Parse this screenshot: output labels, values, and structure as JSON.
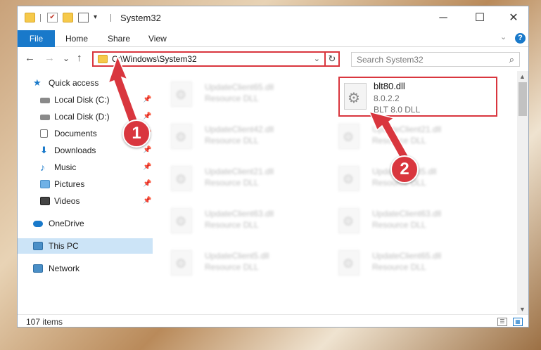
{
  "window": {
    "title": "System32",
    "minimize_glyph": "─",
    "maximize_glyph": "☐",
    "close_glyph": "✕",
    "qat_dropdown_glyph": "▾"
  },
  "ribbon": {
    "tabs": [
      "File",
      "Home",
      "Share",
      "View"
    ],
    "expand_glyph": "⌄",
    "help_glyph": "?"
  },
  "nav": {
    "back": "←",
    "forward": "→",
    "recent": "⌄",
    "up": "↑",
    "address": "C:\\Windows\\System32",
    "address_dropdown": "⌄",
    "refresh": "↻",
    "search_placeholder": "Search System32",
    "search_icon": "⌕"
  },
  "sidebar": {
    "pin_glyph": "📌",
    "items": [
      {
        "label": "Quick access",
        "icon": "star-icon",
        "pinned": false
      },
      {
        "label": "Local Disk (C:)",
        "icon": "drive-icon",
        "pinned": true
      },
      {
        "label": "Local Disk (D:)",
        "icon": "drive-icon",
        "pinned": true
      },
      {
        "label": "Documents",
        "icon": "documents-icon",
        "pinned": true
      },
      {
        "label": "Downloads",
        "icon": "downloads-icon",
        "pinned": true
      },
      {
        "label": "Music",
        "icon": "music-icon",
        "pinned": true
      },
      {
        "label": "Pictures",
        "icon": "pictures-icon",
        "pinned": true
      },
      {
        "label": "Videos",
        "icon": "videos-icon",
        "pinned": true
      },
      {
        "label": "OneDrive",
        "icon": "onedrive-icon",
        "pinned": false
      },
      {
        "label": "This PC",
        "icon": "computer-icon",
        "pinned": false
      },
      {
        "label": "Network",
        "icon": "network-icon",
        "pinned": false
      }
    ]
  },
  "files": [
    {
      "name": "UpdateClient65.dll",
      "desc": "Resource DLL"
    },
    {
      "name": "UpdateClient42.dll",
      "desc": "Resource DLL"
    },
    {
      "name": "UpdateClient21.dll",
      "desc": "Resource DLL"
    },
    {
      "name": "UpdateClient21.dll",
      "desc": "Resource DLL"
    },
    {
      "name": "UpdateClient5.dll",
      "desc": "Resource DLL"
    },
    {
      "name": "UpdateClient63.dll",
      "desc": "Resource DLL"
    },
    {
      "name": "UpdateClient63.dll",
      "desc": "Resource DLL"
    },
    {
      "name": "UpdateClient5.dll",
      "desc": "Resource DLL"
    },
    {
      "name": "UpdateClient65.dll",
      "desc": "Resource DLL"
    }
  ],
  "highlighted_file": {
    "name": "blt80.dll",
    "version": "8.0.2.2",
    "description": "BLT 8.0 DLL",
    "gear_glyph": "⚙"
  },
  "scroll": {
    "up": "▲",
    "down": "▼"
  },
  "status": {
    "item_count": "107 items",
    "details_view": "☰",
    "icons_view": "▦"
  },
  "annotations": {
    "step1": "1",
    "step2": "2",
    "color": "#d9363e"
  }
}
